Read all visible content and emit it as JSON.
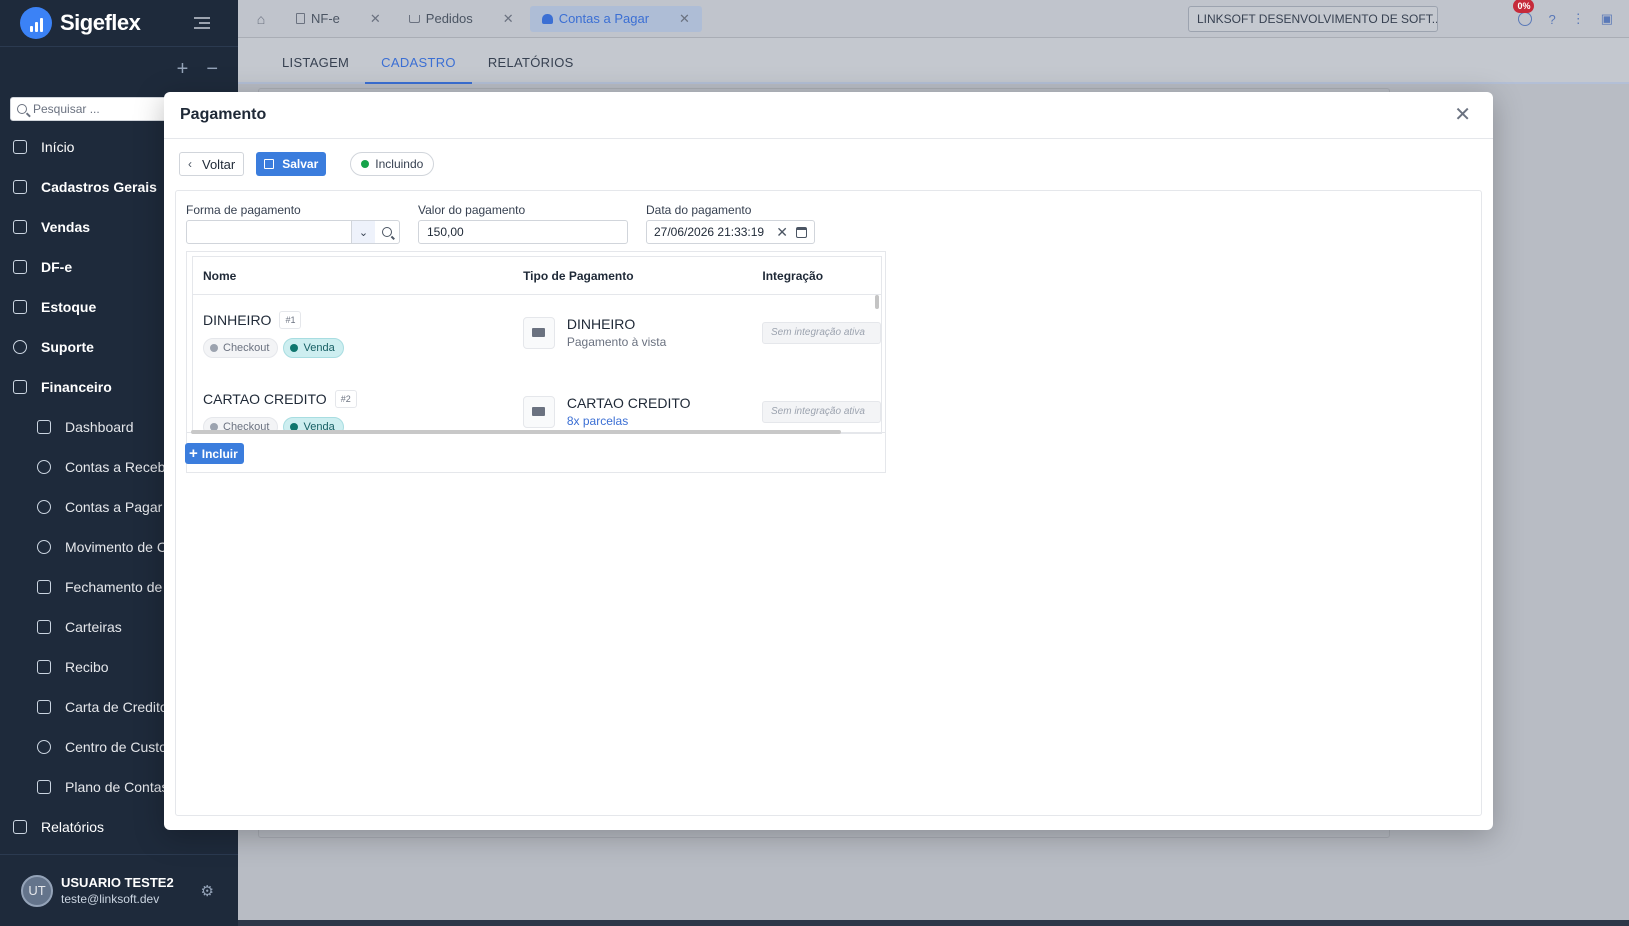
{
  "app": {
    "name": "Sigeflex"
  },
  "sidebar": {
    "search_placeholder": "Pesquisar ...",
    "items": [
      {
        "label": "Início",
        "icon": "home-icon",
        "bold": false
      },
      {
        "label": "Cadastros Gerais",
        "icon": "grid-icon",
        "bold": true
      },
      {
        "label": "Vendas",
        "icon": "bag-icon",
        "bold": true
      },
      {
        "label": "DF-e",
        "icon": "document-icon",
        "bold": true
      },
      {
        "label": "Estoque",
        "icon": "box-icon",
        "bold": true
      },
      {
        "label": "Suporte",
        "icon": "headset-icon",
        "bold": true
      },
      {
        "label": "Financeiro",
        "icon": "bank-icon",
        "bold": true
      }
    ],
    "sub_items": [
      {
        "label": "Dashboard",
        "icon": "dashboard-icon"
      },
      {
        "label": "Contas a Receber",
        "icon": "coin-icon"
      },
      {
        "label": "Contas a Pagar",
        "icon": "people-icon"
      },
      {
        "label": "Movimento de Caixa",
        "icon": "chart-icon"
      },
      {
        "label": "Fechamento de Caixa",
        "icon": "lock-icon"
      },
      {
        "label": "Carteiras",
        "icon": "wallet-icon"
      },
      {
        "label": "Recibo",
        "icon": "receipt-icon"
      },
      {
        "label": "Carta de Credito",
        "icon": "card-icon"
      },
      {
        "label": "Centro de Custo",
        "icon": "pie-icon"
      },
      {
        "label": "Plano de Contas",
        "icon": "list-icon"
      }
    ],
    "relatorios": "Relatórios",
    "user": {
      "initials": "UT",
      "name": "USUARIO TESTE2",
      "email": "teste@linksoft.dev"
    }
  },
  "topbar": {
    "tabs": [
      {
        "label": "NF-e",
        "active": false
      },
      {
        "label": "Pedidos",
        "active": false
      },
      {
        "label": "Contas a Pagar",
        "active": true
      }
    ],
    "company": "LINKSOFT DESENVOLVIMENTO DE SOFT...",
    "notification_badge": "0%"
  },
  "subtabs": [
    "LISTAGEM",
    "CADASTRO",
    "RELATÓRIOS"
  ],
  "modal": {
    "title": "Pagamento",
    "back_label": "Voltar",
    "save_label": "Salvar",
    "status_label": "Incluindo",
    "fields": {
      "forma_label": "Forma de pagamento",
      "forma_value": "",
      "valor_label": "Valor do pagamento",
      "valor_value": "150,00",
      "data_label": "Data do pagamento",
      "data_value": "27/06/2026 21:33:19"
    },
    "table": {
      "headers": [
        "Nome",
        "Tipo de Pagamento",
        "Integração"
      ],
      "rows": [
        {
          "name": "DINHEIRO",
          "index": "#1",
          "chip_gray": "Checkout",
          "chip_green": "Venda",
          "tipo": "DINHEIRO",
          "tipo_sub": "Pagamento à vista",
          "integracao": "Sem integração ativa"
        },
        {
          "name": "CARTAO CREDITO",
          "index": "#2",
          "chip_gray": "Checkout",
          "chip_green": "Venda",
          "tipo": "CARTAO CREDITO",
          "tipo_sub": "8x parcelas",
          "integracao": "Sem integração ativa"
        }
      ]
    },
    "incluir_label": "Incluir"
  }
}
